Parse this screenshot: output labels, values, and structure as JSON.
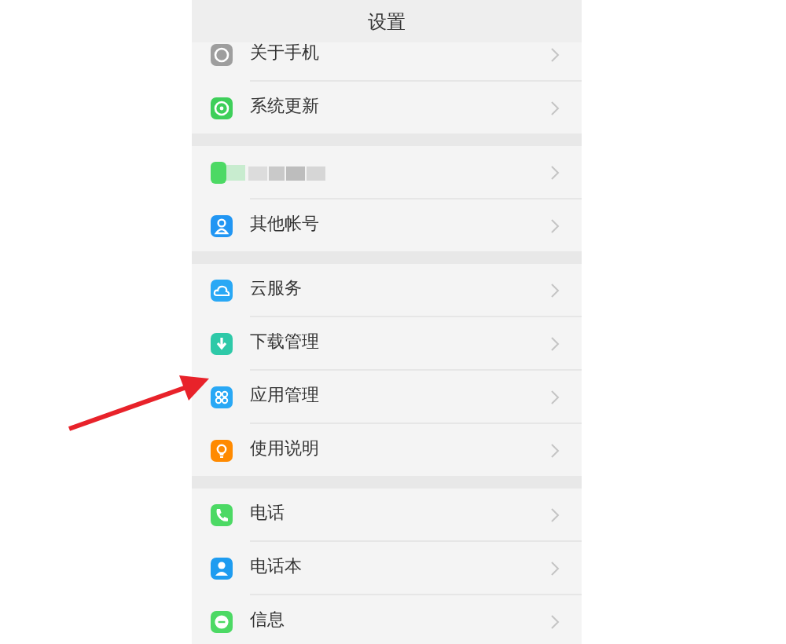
{
  "header": {
    "title": "设置"
  },
  "sections": [
    {
      "rows": [
        {
          "kind": "phone-info",
          "label": "关于手机",
          "color": "#9e9e9e"
        },
        {
          "kind": "refresh",
          "label": "系统更新",
          "color": "#3ecf5a"
        }
      ]
    },
    {
      "rows": [
        {
          "kind": "redacted",
          "color": "#4cd964"
        },
        {
          "kind": "account",
          "label": "其他帐号",
          "color": "#2196f3"
        }
      ]
    },
    {
      "rows": [
        {
          "kind": "cloud",
          "label": "云服务",
          "color": "#29a8f5"
        },
        {
          "kind": "download",
          "label": "下载管理",
          "color": "#2ec9a8"
        },
        {
          "kind": "apps",
          "label": "应用管理",
          "color": "#29a8f5"
        },
        {
          "kind": "bulb",
          "label": "使用说明",
          "color": "#ff8a00"
        }
      ]
    },
    {
      "rows": [
        {
          "kind": "phone",
          "label": "电话",
          "color": "#4cd964"
        },
        {
          "kind": "contact",
          "label": "电话本",
          "color": "#1e9cf0"
        },
        {
          "kind": "message",
          "label": "信息",
          "color": "#4cd964"
        }
      ]
    }
  ]
}
